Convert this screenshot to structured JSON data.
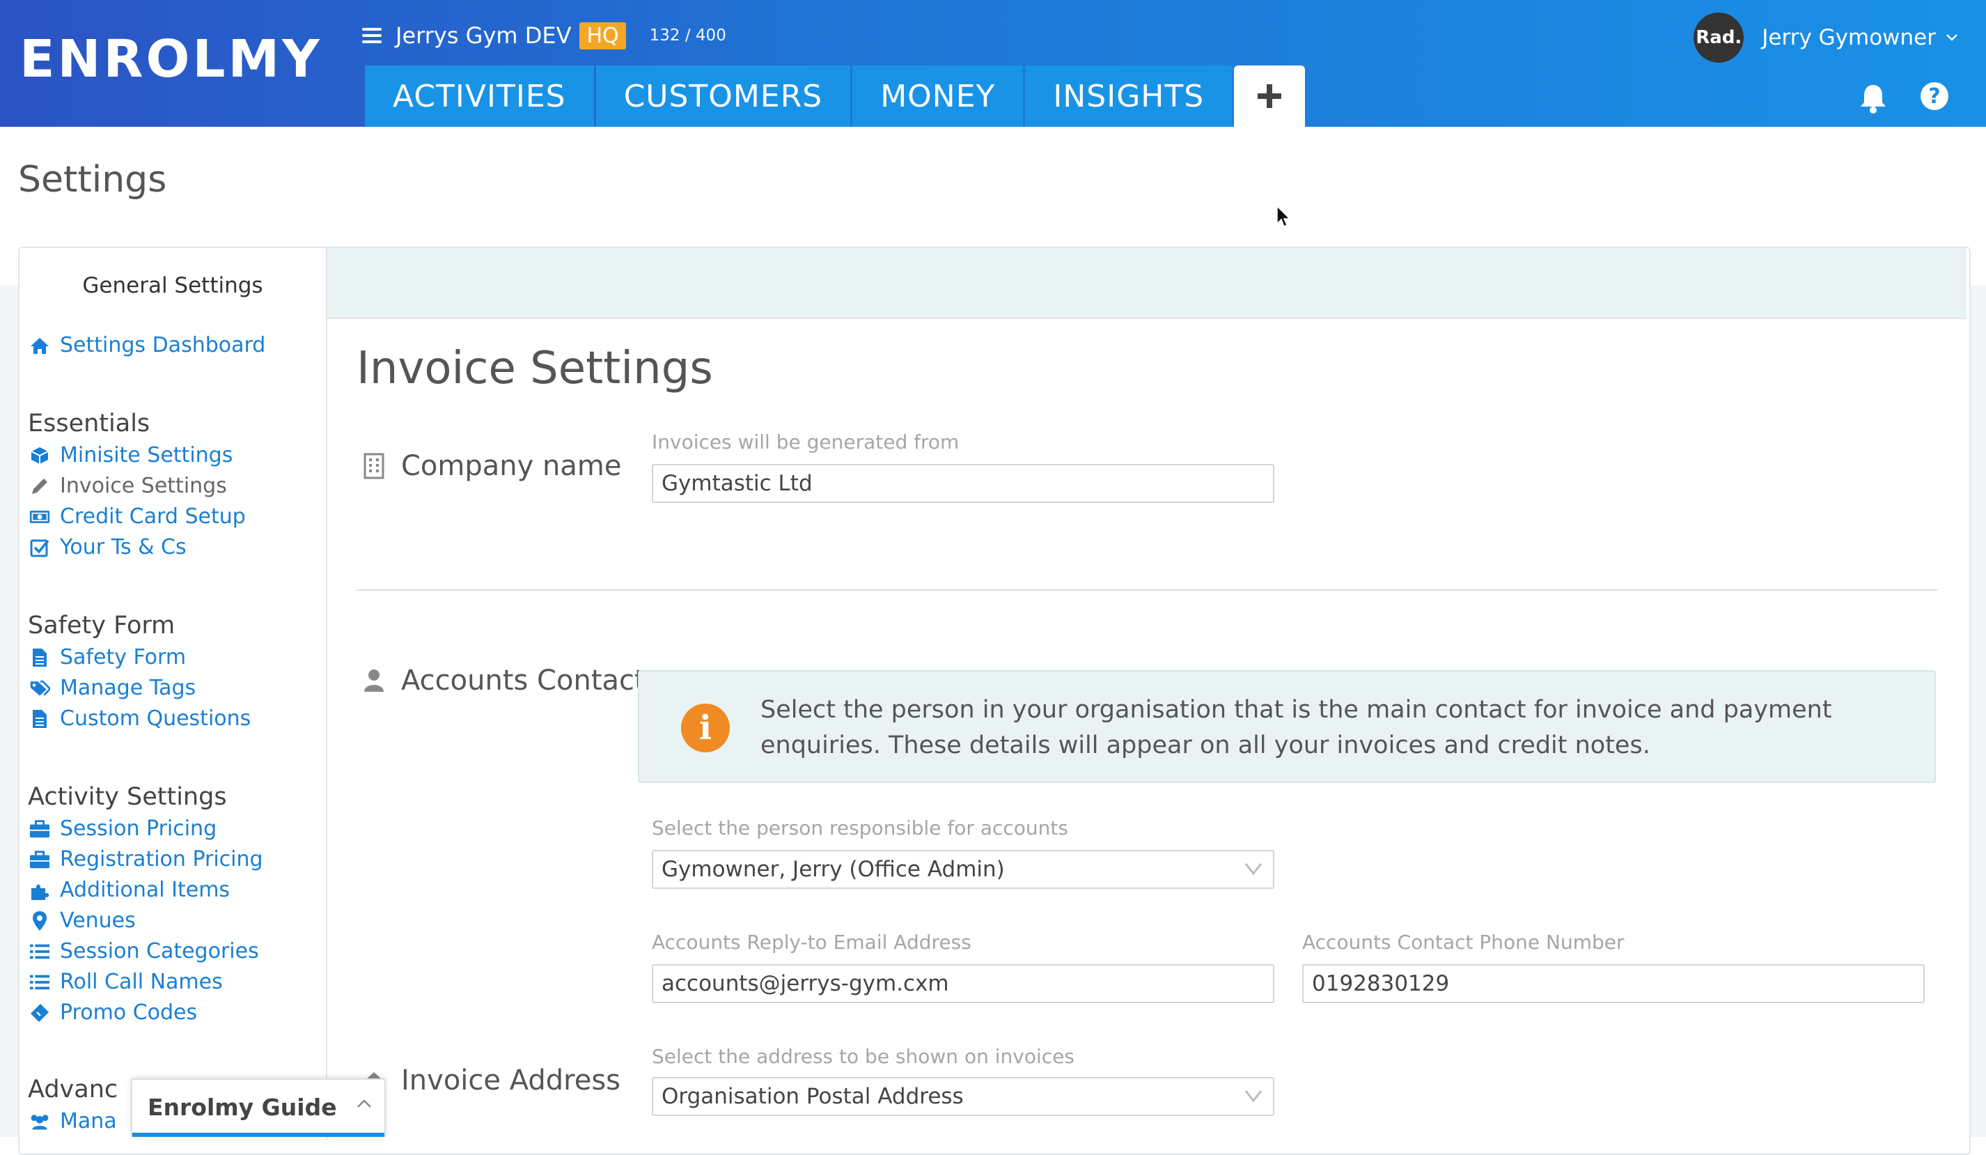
{
  "header": {
    "logo": "ENROLMY",
    "org_name": "Jerrys Gym DEV",
    "org_badge": "HQ",
    "usage_count": "132 / 400",
    "tabs": [
      "ACTIVITIES",
      "CUSTOMERS",
      "MONEY",
      "INSIGHTS"
    ],
    "add_tab_label": "+",
    "user": {
      "avatar_text": "Rad.",
      "name": "Jerry Gymowner"
    },
    "help_label": "?"
  },
  "page": {
    "title": "Settings"
  },
  "sidebar": {
    "header": "General Settings",
    "dashboard": "Settings Dashboard",
    "sections": [
      {
        "title": "Essentials",
        "items": [
          "Minisite Settings",
          "Invoice Settings",
          "Credit Card Setup",
          "Your Ts & Cs"
        ]
      },
      {
        "title": "Safety Form",
        "items": [
          "Safety Form",
          "Manage Tags",
          "Custom Questions"
        ]
      },
      {
        "title": "Activity Settings",
        "items": [
          "Session Pricing",
          "Registration Pricing",
          "Additional Items",
          "Venues",
          "Session Categories",
          "Roll Call Names",
          "Promo Codes"
        ]
      },
      {
        "title": "Advanc",
        "items": [
          "Mana"
        ]
      }
    ]
  },
  "main": {
    "heading": "Invoice Settings",
    "company": {
      "label": "Company name",
      "field_label": "Invoices will be generated from",
      "value": "Gymtastic Ltd"
    },
    "accounts": {
      "label": "Accounts Contact",
      "info": "Select the person in your organisation that is the main contact for invoice and payment enquiries. These details will appear on all your invoices and credit notes.",
      "person_label": "Select the person responsible for accounts",
      "person_value": "Gymowner, Jerry (Office Admin)",
      "email_label": "Accounts Reply-to Email Address",
      "email_value": "accounts@jerrys-gym.cxm",
      "phone_label": "Accounts Contact Phone Number",
      "phone_value": "0192830129"
    },
    "address": {
      "label": "Invoice Address",
      "field_label": "Select the address to be shown on invoices",
      "value": "Organisation Postal Address"
    }
  },
  "guide": {
    "title": "Enrolmy Guide"
  },
  "colors": {
    "brand_blue": "#1a7fd4",
    "accent_orange": "#f5a623",
    "info_orange": "#f08a24"
  }
}
